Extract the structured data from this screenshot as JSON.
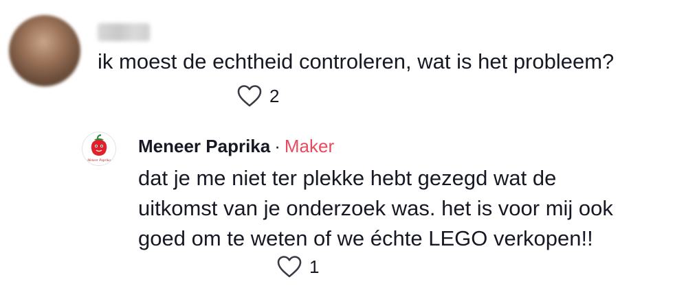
{
  "comment": {
    "text": "ik moest de echtheid controleren, wat is het probleem?",
    "likes": "2"
  },
  "reply": {
    "author": "Meneer Paprika",
    "separator": "·",
    "badge": "Maker",
    "avatar_caption": "Meneer Paprika",
    "lines": [
      "dat je me niet ter plekke hebt gezegd wat de",
      "uitkomst van je onderzoek was. het is voor mij ook",
      "goed om te weten of we échte LEGO verkopen!!"
    ],
    "likes": "1"
  },
  "colors": {
    "text": "#161823",
    "badge": "#e84a5f",
    "icon_stroke": "#3a3a44"
  }
}
